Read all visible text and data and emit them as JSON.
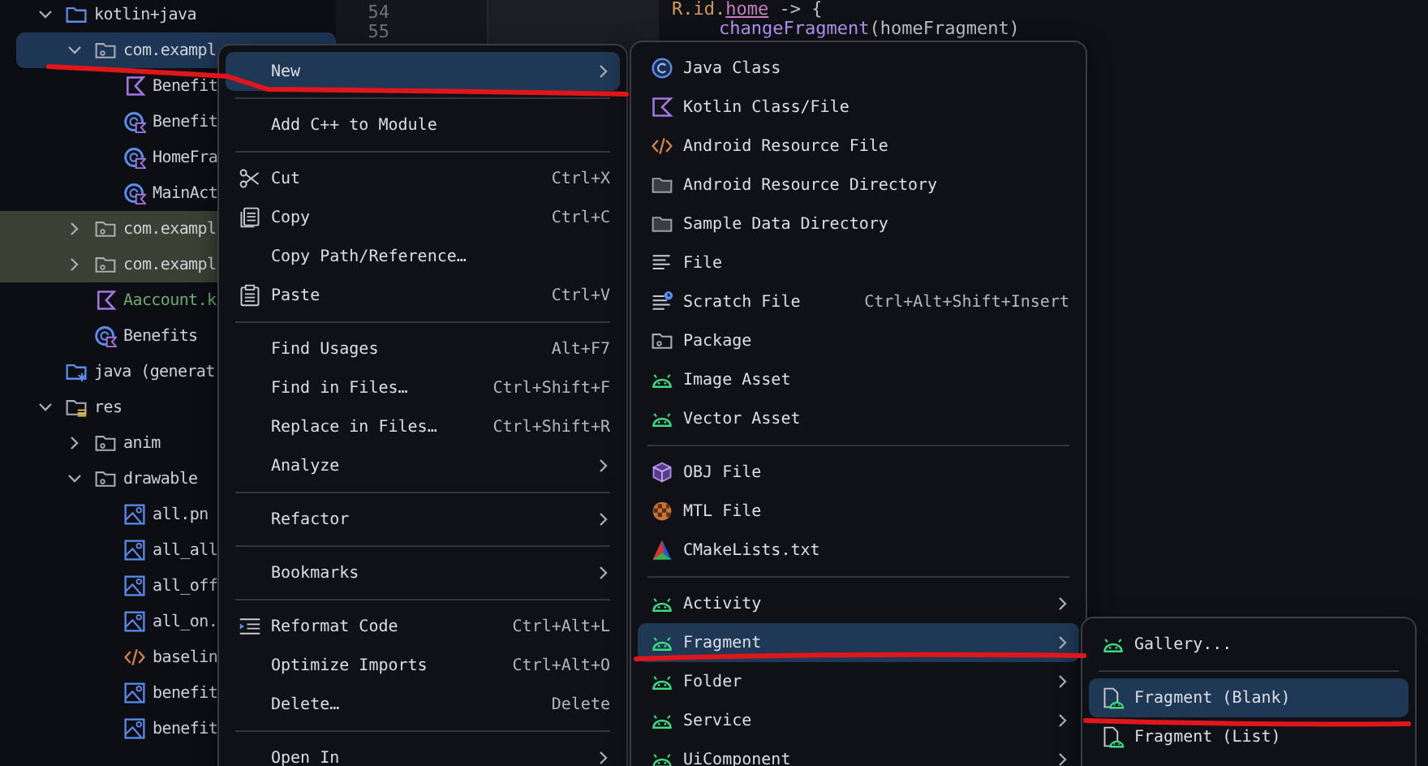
{
  "project_tree": {
    "items": [
      {
        "label": "kotlin+java",
        "kind": "folder",
        "expanded": true,
        "selected": false,
        "tinted": false,
        "children": [
          {
            "label": "com.exampl",
            "kind": "package",
            "expanded": true,
            "selected": true,
            "tinted": false,
            "children": [
              {
                "label": "Benefit",
                "kind": "kotlin-file",
                "selected": false,
                "tinted": false
              },
              {
                "label": "Benefit",
                "kind": "kotlin-class",
                "selected": false,
                "tinted": false
              },
              {
                "label": "HomeFra",
                "kind": "kotlin-class",
                "selected": false,
                "tinted": false
              },
              {
                "label": "MainAct",
                "kind": "kotlin-class",
                "selected": false,
                "tinted": false
              }
            ]
          },
          {
            "label": "com.exampl",
            "kind": "package",
            "expanded": false,
            "selected": false,
            "tinted": true
          },
          {
            "label": "com.exampl",
            "kind": "package",
            "expanded": false,
            "selected": false,
            "tinted": true
          },
          {
            "label": "Aaccount.k",
            "kind": "kotlin-file",
            "selected": false,
            "tinted": false,
            "color": "#6aab73"
          },
          {
            "label": "Benefits",
            "kind": "kotlin-class",
            "selected": false,
            "tinted": false
          }
        ]
      },
      {
        "label": "java (generat",
        "kind": "generated-folder",
        "selected": false,
        "tinted": false
      },
      {
        "label": "res",
        "kind": "res-folder",
        "expanded": true,
        "selected": false,
        "tinted": false,
        "children": [
          {
            "label": "anim",
            "kind": "package",
            "expanded": false,
            "selected": false,
            "tinted": false
          },
          {
            "label": "drawable",
            "kind": "package",
            "expanded": true,
            "selected": false,
            "tinted": false,
            "children": [
              {
                "label": "all.pn",
                "kind": "image",
                "selected": false,
                "tinted": false
              },
              {
                "label": "all_all",
                "kind": "image",
                "selected": false,
                "tinted": false
              },
              {
                "label": "all_off",
                "kind": "image",
                "selected": false,
                "tinted": false
              },
              {
                "label": "all_on.",
                "kind": "image",
                "selected": false,
                "tinted": false
              },
              {
                "label": "baselin",
                "kind": "code",
                "selected": false,
                "tinted": false
              },
              {
                "label": "benefit",
                "kind": "image",
                "selected": false,
                "tinted": false
              },
              {
                "label": "benefit",
                "kind": "image",
                "selected": false,
                "tinted": false
              }
            ]
          }
        ]
      }
    ]
  },
  "editor": {
    "line_numbers": [
      "54",
      "55"
    ],
    "lines": [
      {
        "kind": "open",
        "tokens": [
          {
            "text": "R.id.",
            "kind": "ref"
          },
          {
            "text": "home",
            "kind": "field"
          },
          {
            "text": " -> {",
            "kind": "plain"
          }
        ]
      },
      {
        "kind": "statement",
        "tokens": [
          {
            "text": "changeFragment",
            "kind": "call"
          },
          {
            "text": "(homeFragment)",
            "kind": "plain"
          }
        ]
      }
    ]
  },
  "context_menus": [
    {
      "items": [
        {
          "kind": "plain",
          "label": "New",
          "submenu": true,
          "selected": true
        },
        {
          "kind": "separator"
        },
        {
          "kind": "plain",
          "label": "Add C++ to Module",
          "submenu": false,
          "selected": false
        },
        {
          "kind": "separator"
        },
        {
          "kind": "scissors",
          "label": "Cut",
          "shortcut": "Ctrl+X",
          "submenu": false,
          "selected": false
        },
        {
          "kind": "copy",
          "label": "Copy",
          "shortcut": "Ctrl+C",
          "submenu": false,
          "selected": false
        },
        {
          "kind": "plain",
          "label": "Copy Path/Reference…",
          "submenu": false,
          "selected": false
        },
        {
          "kind": "paste",
          "label": "Paste",
          "shortcut": "Ctrl+V",
          "submenu": false,
          "selected": false
        },
        {
          "kind": "separator"
        },
        {
          "kind": "plain",
          "label": "Find Usages",
          "shortcut": "Alt+F7",
          "submenu": false,
          "selected": false
        },
        {
          "kind": "plain",
          "label": "Find in Files…",
          "shortcut": "Ctrl+Shift+F",
          "submenu": false,
          "selected": false
        },
        {
          "kind": "plain",
          "label": "Replace in Files…",
          "shortcut": "Ctrl+Shift+R",
          "submenu": false,
          "selected": false
        },
        {
          "kind": "plain",
          "label": "Analyze",
          "submenu": true,
          "selected": false
        },
        {
          "kind": "separator"
        },
        {
          "kind": "plain",
          "label": "Refactor",
          "submenu": true,
          "selected": false
        },
        {
          "kind": "separator"
        },
        {
          "kind": "plain",
          "label": "Bookmarks",
          "submenu": true,
          "selected": false
        },
        {
          "kind": "separator"
        },
        {
          "kind": "reformat",
          "label": "Reformat Code",
          "shortcut": "Ctrl+Alt+L",
          "submenu": false,
          "selected": false
        },
        {
          "kind": "plain",
          "label": "Optimize Imports",
          "shortcut": "Ctrl+Alt+O",
          "submenu": false,
          "selected": false
        },
        {
          "kind": "plain",
          "label": "Delete…",
          "shortcut": "Delete",
          "submenu": false,
          "selected": false
        },
        {
          "kind": "separator"
        },
        {
          "kind": "plain",
          "label": "Open In",
          "submenu": true,
          "selected": false
        }
      ]
    },
    {
      "items": [
        {
          "kind": "java-class",
          "label": "Java Class",
          "submenu": false,
          "selected": false
        },
        {
          "kind": "kotlin",
          "label": "Kotlin Class/File",
          "submenu": false,
          "selected": false
        },
        {
          "kind": "code",
          "label": "Android Resource File",
          "submenu": false,
          "selected": false
        },
        {
          "kind": "folder-grey",
          "label": "Android Resource Directory",
          "submenu": false,
          "selected": false
        },
        {
          "kind": "folder-grey",
          "label": "Sample Data Directory",
          "submenu": false,
          "selected": false
        },
        {
          "kind": "lines",
          "label": "File",
          "submenu": false,
          "selected": false
        },
        {
          "kind": "scratch",
          "label": "Scratch File",
          "shortcut": "Ctrl+Alt+Shift+Insert",
          "submenu": false,
          "selected": false
        },
        {
          "kind": "package",
          "label": "Package",
          "submenu": false,
          "selected": false
        },
        {
          "kind": "android",
          "label": "Image Asset",
          "submenu": false,
          "selected": false
        },
        {
          "kind": "android",
          "label": "Vector Asset",
          "submenu": false,
          "selected": false
        },
        {
          "kind": "separator"
        },
        {
          "kind": "cube",
          "label": "OBJ File",
          "submenu": false,
          "selected": false
        },
        {
          "kind": "ball",
          "label": "MTL File",
          "submenu": false,
          "selected": false
        },
        {
          "kind": "triangle",
          "label": "CMakeLists.txt",
          "submenu": false,
          "selected": false
        },
        {
          "kind": "separator"
        },
        {
          "kind": "android",
          "label": "Activity",
          "submenu": true,
          "selected": false
        },
        {
          "kind": "android",
          "label": "Fragment",
          "submenu": true,
          "selected": true
        },
        {
          "kind": "android",
          "label": "Folder",
          "submenu": true,
          "selected": false
        },
        {
          "kind": "android",
          "label": "Service",
          "submenu": true,
          "selected": false
        },
        {
          "kind": "android",
          "label": "UiComponent",
          "submenu": true,
          "selected": false
        }
      ]
    },
    {
      "items": [
        {
          "kind": "android",
          "label": "Gallery...",
          "submenu": false,
          "selected": false
        },
        {
          "kind": "separator"
        },
        {
          "kind": "fragment",
          "label": "Fragment (Blank)",
          "submenu": false,
          "selected": true
        },
        {
          "kind": "fragment",
          "label": "Fragment (List)",
          "submenu": false,
          "selected": false
        }
      ]
    }
  ]
}
